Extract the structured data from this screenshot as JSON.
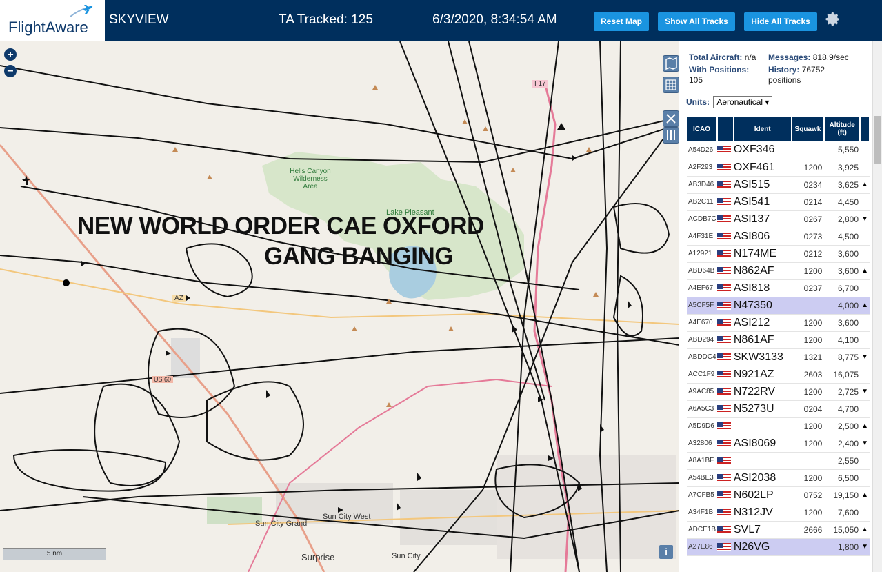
{
  "header": {
    "logo_text": "FlightAware",
    "app_title": "SKYVIEW",
    "tracked": "TA Tracked: 125",
    "datetime": "6/3/2020, 8:34:54 AM",
    "buttons": {
      "reset_map": "Reset Map",
      "show_all": "Show All Tracks",
      "hide_all": "Hide All Tracks"
    },
    "accent_color": "#1a94e0",
    "bg_color": "#002f5d"
  },
  "map": {
    "overlay_line1": "NEW WORLD ORDER CAE OXFORD",
    "overlay_line2": "GANG BANGING",
    "scale_label": "5 nm",
    "info_label": "i",
    "places": {
      "hells_canyon": "Hells Canyon Wilderness Area",
      "lake_pleasant": "Lake Pleasant",
      "sun_city_west": "Sun City West",
      "sun_city_grand": "Sun City Grand",
      "sun_city": "Sun City",
      "surprise": "Surprise",
      "i17": "I 17",
      "az74": "AZ",
      "us60": "US 60"
    }
  },
  "stats": {
    "total_aircraft_label": "Total Aircraft:",
    "total_aircraft_value": "n/a",
    "messages_label": "Messages:",
    "messages_value": "818.9/sec",
    "with_positions_label": "With Positions:",
    "with_positions_value": "105",
    "history_label": "History:",
    "history_value": "76752",
    "history_unit": "positions"
  },
  "units": {
    "label": "Units:",
    "selected": "Aeronautical"
  },
  "table": {
    "headers": {
      "icao": "ICAO",
      "ident": "Ident",
      "squawk": "Squawk",
      "altitude": "Altitude (ft)"
    },
    "rows": [
      {
        "icao": "A54D26",
        "ident": "OXF346",
        "squawk": "",
        "alt": "5,550",
        "arrow": ""
      },
      {
        "icao": "A2F293",
        "ident": "OXF461",
        "squawk": "1200",
        "alt": "3,925",
        "arrow": ""
      },
      {
        "icao": "AB3D46",
        "ident": "ASI515",
        "squawk": "0234",
        "alt": "3,625",
        "arrow": "▲"
      },
      {
        "icao": "AB2C11",
        "ident": "ASI541",
        "squawk": "0214",
        "alt": "4,450",
        "arrow": ""
      },
      {
        "icao": "ACDB7C",
        "ident": "ASI137",
        "squawk": "0267",
        "alt": "2,800",
        "arrow": "▼"
      },
      {
        "icao": "A4F31E",
        "ident": "ASI806",
        "squawk": "0273",
        "alt": "4,500",
        "arrow": ""
      },
      {
        "icao": "A12921",
        "ident": "N174ME",
        "squawk": "0212",
        "alt": "3,600",
        "arrow": ""
      },
      {
        "icao": "ABD64B",
        "ident": "N862AF",
        "squawk": "1200",
        "alt": "3,600",
        "arrow": "▲"
      },
      {
        "icao": "A4EF67",
        "ident": "ASI818",
        "squawk": "0237",
        "alt": "6,700",
        "arrow": ""
      },
      {
        "icao": "A5CF5F",
        "ident": "N47350",
        "squawk": "",
        "alt": "4,000",
        "arrow": "▲",
        "selected": true
      },
      {
        "icao": "A4E670",
        "ident": "ASI212",
        "squawk": "1200",
        "alt": "3,600",
        "arrow": ""
      },
      {
        "icao": "ABD294",
        "ident": "N861AF",
        "squawk": "1200",
        "alt": "4,100",
        "arrow": ""
      },
      {
        "icao": "ABDDC4",
        "ident": "SKW3133",
        "squawk": "1321",
        "alt": "8,775",
        "arrow": "▼"
      },
      {
        "icao": "ACC1F9",
        "ident": "N921AZ",
        "squawk": "2603",
        "alt": "16,075",
        "arrow": ""
      },
      {
        "icao": "A9AC85",
        "ident": "N722RV",
        "squawk": "1200",
        "alt": "2,725",
        "arrow": "▼"
      },
      {
        "icao": "A6A5C3",
        "ident": "N5273U",
        "squawk": "0204",
        "alt": "4,700",
        "arrow": ""
      },
      {
        "icao": "A5D9D6",
        "ident": "",
        "squawk": "1200",
        "alt": "2,500",
        "arrow": "▲"
      },
      {
        "icao": "A32806",
        "ident": "ASI8069",
        "squawk": "1200",
        "alt": "2,400",
        "arrow": "▼"
      },
      {
        "icao": "A8A1BF",
        "ident": "",
        "squawk": "",
        "alt": "2,550",
        "arrow": ""
      },
      {
        "icao": "A54BE3",
        "ident": "ASI2038",
        "squawk": "1200",
        "alt": "6,500",
        "arrow": ""
      },
      {
        "icao": "A7CFB5",
        "ident": "N602LP",
        "squawk": "0752",
        "alt": "19,150",
        "arrow": "▲"
      },
      {
        "icao": "A34F1B",
        "ident": "N312JV",
        "squawk": "1200",
        "alt": "7,600",
        "arrow": ""
      },
      {
        "icao": "ADCE1B",
        "ident": "SVL7",
        "squawk": "2666",
        "alt": "15,050",
        "arrow": "▲"
      },
      {
        "icao": "A27E86",
        "ident": "N26VG",
        "squawk": "",
        "alt": "1,800",
        "arrow": "▼",
        "selected": true
      }
    ]
  }
}
